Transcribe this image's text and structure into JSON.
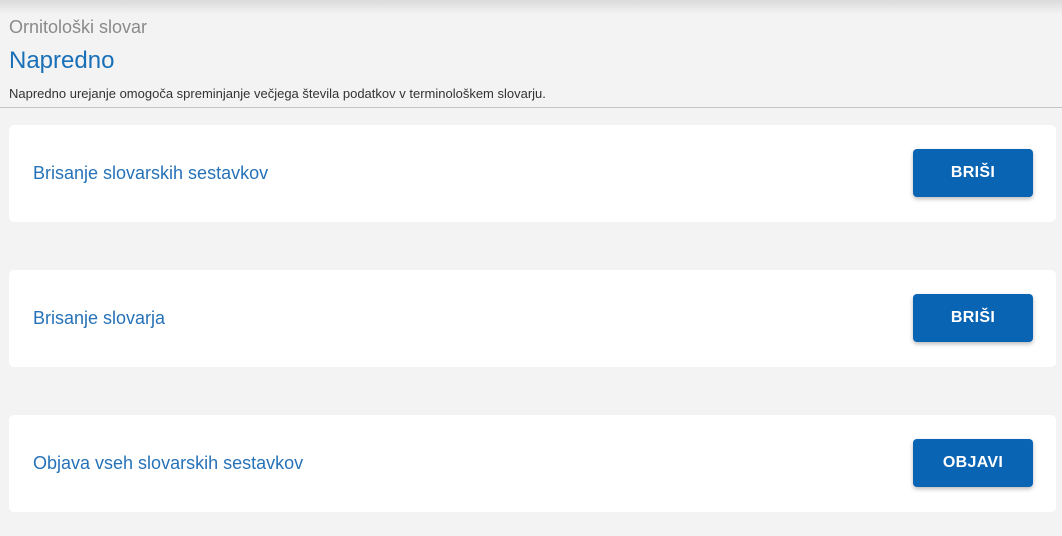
{
  "header": {
    "dictionary_name": "Ornitološki slovar",
    "page_title": "Napredno",
    "description": "Napredno urejanje omogoča spreminjanje večjega števila podatkov v terminološkem slovarju."
  },
  "cards": [
    {
      "label": "Brisanje slovarskih sestavkov",
      "button_label": "BRIŠI"
    },
    {
      "label": "Brisanje slovarja",
      "button_label": "BRIŠI"
    },
    {
      "label": "Objava vseh slovarskih sestavkov",
      "button_label": "OBJAVI"
    }
  ],
  "colors": {
    "accent": "#1a70b8",
    "button": "#0a64b4",
    "background": "#f3f3f3"
  }
}
